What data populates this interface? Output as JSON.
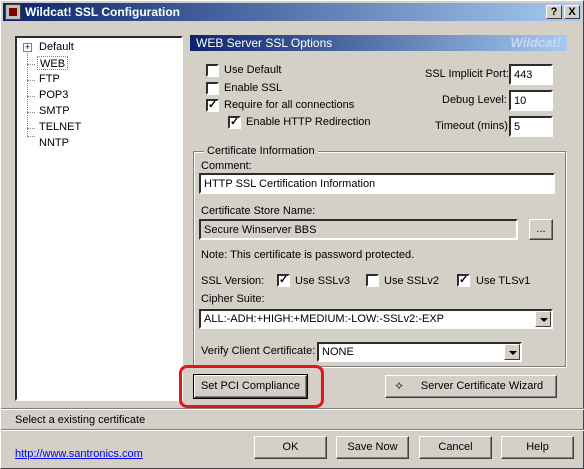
{
  "window": {
    "title": "Wildcat! SSL Configuration",
    "help_btn": "?",
    "close_btn": "X"
  },
  "tree": {
    "items": [
      {
        "label": "Default",
        "expander": "+"
      },
      {
        "label": "WEB"
      },
      {
        "label": "FTP"
      },
      {
        "label": "POP3"
      },
      {
        "label": "SMTP"
      },
      {
        "label": "TELNET"
      },
      {
        "label": "NNTP"
      }
    ]
  },
  "header": {
    "title": "WEB Server SSL Options",
    "brand": "Wildcat!"
  },
  "options": {
    "use_default": {
      "label": "Use Default",
      "checked": false
    },
    "enable_ssl": {
      "label": "Enable SSL",
      "checked": false
    },
    "require_all": {
      "label": "Require for all connections",
      "checked": true
    },
    "enable_redirect": {
      "label": "Enable HTTP Redirection",
      "checked": true
    },
    "check_mark": "✓"
  },
  "ports": {
    "implicit_port_label": "SSL Implicit Port:",
    "implicit_port_value": "443",
    "debug_level_label": "Debug Level:",
    "debug_level_value": "10",
    "timeout_label": "Timeout (mins)",
    "timeout_value": "5"
  },
  "certificate": {
    "group_title": "Certificate Information",
    "comment_label": "Comment:",
    "comment_value": "HTTP SSL Certification Information",
    "store_label": "Certificate Store Name:",
    "store_value": "Secure Winserver BBS",
    "browse_label": "...",
    "note": "Note: This certificate is password protected.",
    "ssl_version_label": "SSL Version:",
    "sslv3": {
      "label": "Use SSLv3",
      "checked": true
    },
    "sslv2": {
      "label": "Use SSLv2",
      "checked": false
    },
    "tlsv1": {
      "label": "Use TLSv1",
      "checked": true
    },
    "cipher_label": "Cipher Suite:",
    "cipher_value": "ALL:-ADH:+HIGH:+MEDIUM:-LOW:-SSLv2:-EXP",
    "verify_label": "Verify Client Certificate:",
    "verify_value": "NONE"
  },
  "actions": {
    "pci_button": "Set PCI Compliance",
    "wizard_button": "Server Certificate Wizard",
    "ok": "OK",
    "save_now": "Save Now",
    "cancel": "Cancel",
    "help": "Help"
  },
  "status": {
    "text": "Select a existing certificate",
    "link": "http://www.santronics.com"
  },
  "colors": {
    "highlight_ring": "#e4161c",
    "title_gradient_start": "#0a246a",
    "title_gradient_end": "#a6caf0"
  }
}
